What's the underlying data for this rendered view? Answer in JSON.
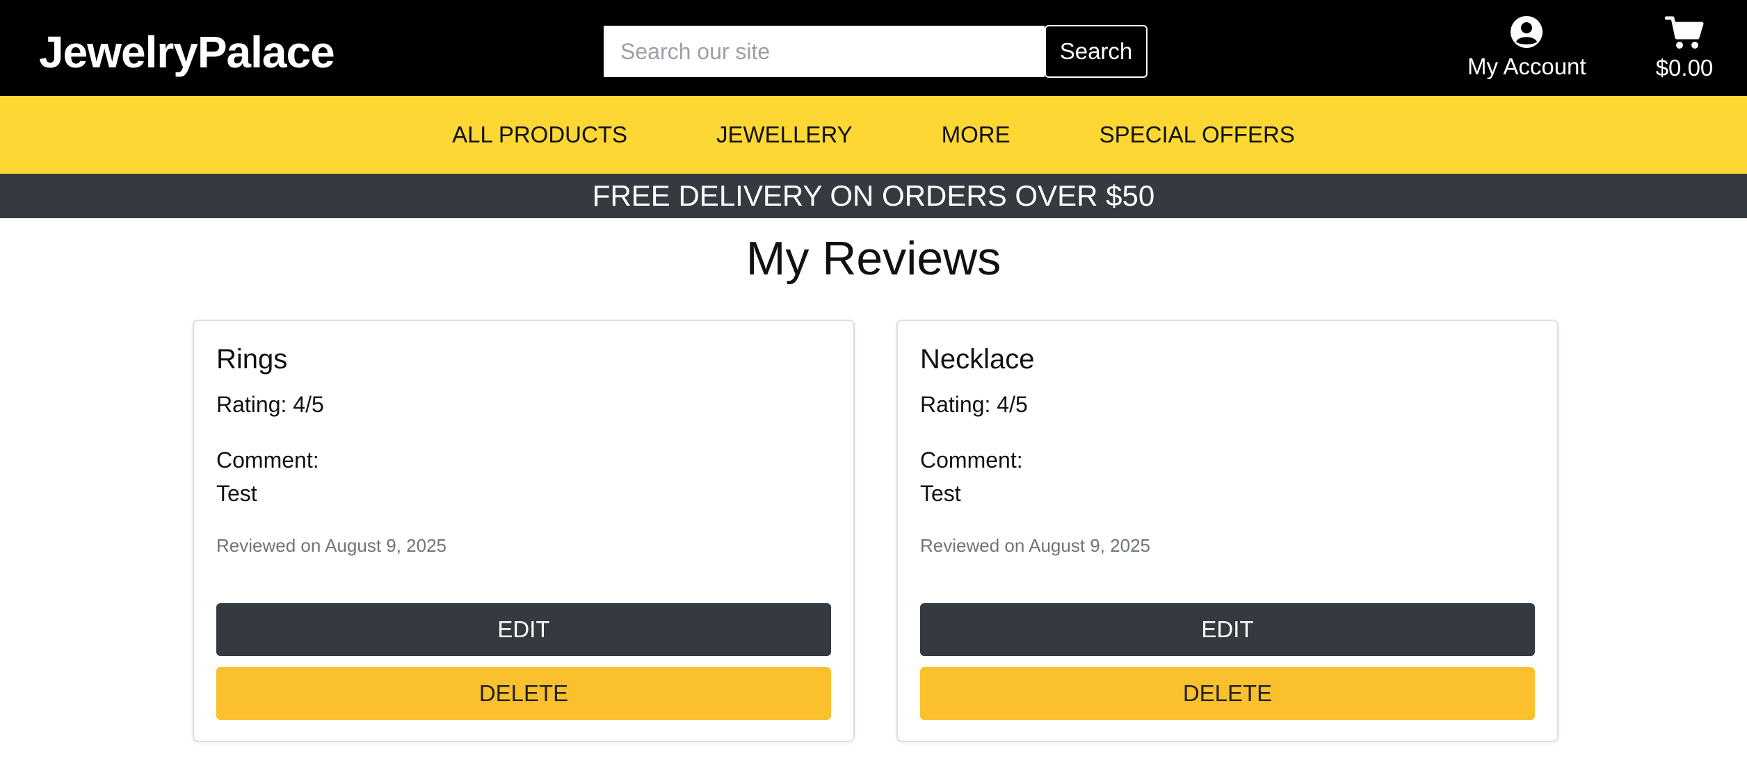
{
  "header": {
    "brand": "JewelryPalace",
    "search": {
      "placeholder": "Search our site",
      "value": "",
      "button_label": "Search"
    },
    "account": {
      "icon": "user-circle-icon",
      "label": "My Account"
    },
    "cart": {
      "icon": "shopping-cart-icon",
      "total": "$0.00"
    }
  },
  "nav": {
    "items": [
      {
        "label": "ALL PRODUCTS"
      },
      {
        "label": "JEWELLERY"
      },
      {
        "label": "MORE"
      },
      {
        "label": "SPECIAL OFFERS"
      }
    ]
  },
  "promo": {
    "text": "FREE DELIVERY ON ORDERS OVER $50"
  },
  "main": {
    "title": "My Reviews",
    "reviews": [
      {
        "product": "Rings",
        "rating": "Rating: 4/5",
        "comment_label": "Comment:",
        "comment": "Test",
        "date": "Reviewed on August 9, 2025",
        "edit_label": "EDIT",
        "delete_label": "DELETE"
      },
      {
        "product": "Necklace",
        "rating": "Rating: 4/5",
        "comment_label": "Comment:",
        "comment": "Test",
        "date": "Reviewed on August 9, 2025",
        "edit_label": "EDIT",
        "delete_label": "DELETE"
      }
    ]
  },
  "colors": {
    "header_bg": "#000000",
    "nav_bg": "#fdd835",
    "promo_bg": "#343a40",
    "edit_button": "#343a40",
    "delete_button": "#fbc02d"
  }
}
